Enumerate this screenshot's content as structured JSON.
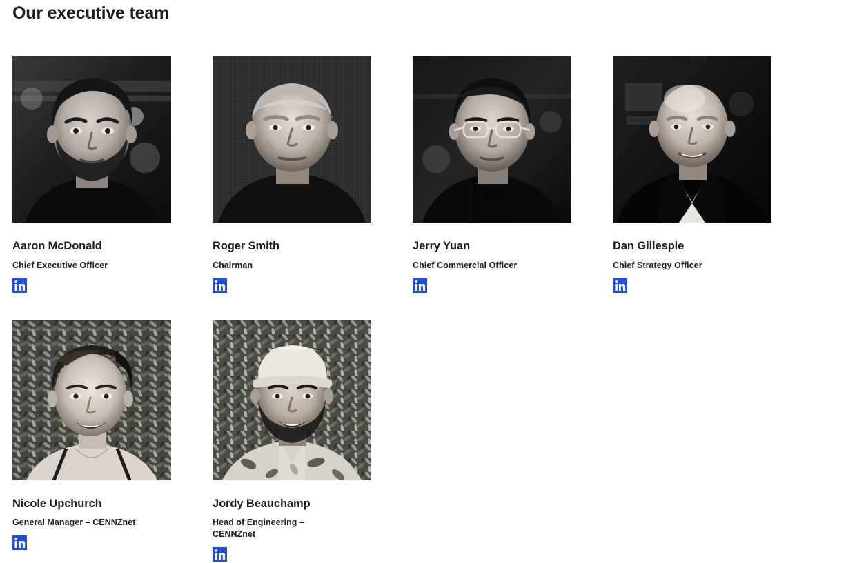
{
  "page": {
    "title": "Our executive team",
    "background_color": "#ffffff",
    "text_color": "#1d1d1f"
  },
  "social": {
    "linkedin_icon_name": "linkedin-icon",
    "linkedin_brand_color": "#1f4fe0",
    "linkedin_glyph": "in"
  },
  "team": {
    "rows": [
      {
        "members": [
          {
            "name": "Aaron McDonald",
            "role": "Chief Executive Officer",
            "photo_alt": "Portrait of Aaron McDonald",
            "photo_style": "bw-portrait-bearded-man-dark-shirt"
          },
          {
            "name": "Roger Smith",
            "role": "Chairman",
            "photo_alt": "Portrait of Roger Smith",
            "photo_style": "bw-portrait-older-man-textured-background"
          },
          {
            "name": "Jerry Yuan",
            "role": "Chief Commercial Officer",
            "photo_alt": "Portrait of Jerry Yuan",
            "photo_style": "bw-portrait-man-glasses-dark-background"
          },
          {
            "name": "Dan Gillespie",
            "role": "Chief Strategy Officer",
            "photo_alt": "Portrait of Dan Gillespie",
            "photo_style": "bw-portrait-man-suit-white-shirt"
          }
        ]
      },
      {
        "members": [
          {
            "name": "Nicole Upchurch",
            "role": "General Manager – CENNZnet",
            "photo_alt": "Portrait of Nicole Upchurch",
            "photo_style": "bw-portrait-woman-foliage-background"
          },
          {
            "name": "Jordy Beauchamp",
            "role": "Head of Engineering – CENNZnet",
            "photo_alt": "Portrait of Jordy Beauchamp",
            "photo_style": "bw-portrait-man-cap-foliage-background"
          }
        ]
      }
    ]
  }
}
